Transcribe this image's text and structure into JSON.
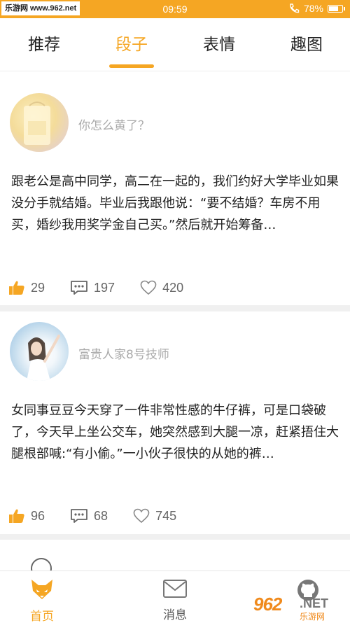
{
  "status_bar": {
    "watermark_text": "乐游网 www.962.net",
    "time": "09:59",
    "battery": "78%",
    "battery_level": 0.78
  },
  "tabs": [
    {
      "label": "推荐",
      "active": false
    },
    {
      "label": "段子",
      "active": true
    },
    {
      "label": "表情",
      "active": false
    },
    {
      "label": "趣图",
      "active": false
    }
  ],
  "posts": [
    {
      "username": "你怎么黄了？",
      "content": "跟老公是高中同学，高二在一起的，我们约好大学毕业如果没分手就结婚。毕业后我跟他说：“要不结婚？车房不用买，婚纱我用奖学金自己买。”然后就开始筹备…",
      "likes": "29",
      "comments": "197",
      "favorites": "420"
    },
    {
      "username": "富贵人家8号技师",
      "content": "女同事豆豆今天穿了一件非常性感的牛仔裤，可是口袋破了，今天早上坐公交车，她突然感到大腿一凉，赶紧捂住大腿根部喊:“有小偷。”一小伙子很快的从她的裤…",
      "likes": "96",
      "comments": "68",
      "favorites": "745"
    }
  ],
  "bottom_nav": [
    {
      "label": "首页",
      "icon": "fox-icon",
      "active": true
    },
    {
      "label": "消息",
      "icon": "mail-icon",
      "active": false
    },
    {
      "label": "",
      "icon": "github-icon",
      "active": false
    }
  ],
  "logo": {
    "big": "962",
    "net": ".NET",
    "sub": "乐游网"
  },
  "colors": {
    "accent": "#f5a623",
    "text": "#222222",
    "muted": "#aaaaaa"
  }
}
